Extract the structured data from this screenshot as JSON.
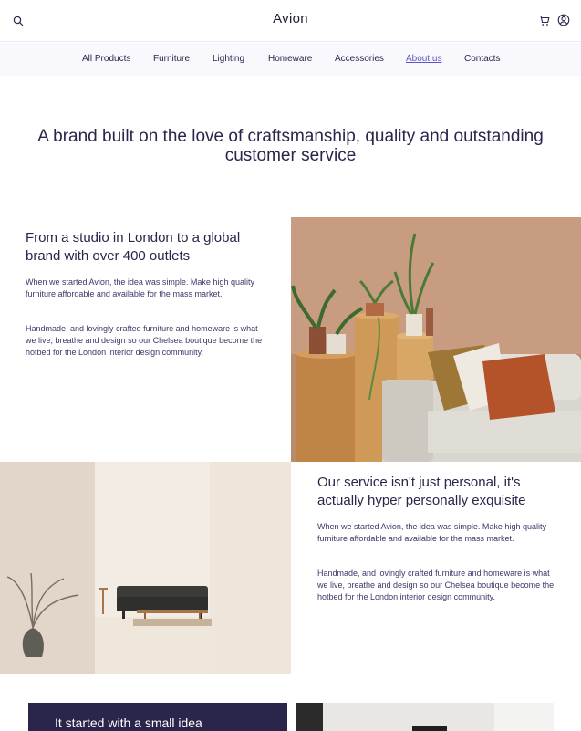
{
  "header": {
    "brand": "Avion",
    "icons": [
      "search-icon",
      "cart-icon",
      "user-icon"
    ]
  },
  "nav": {
    "items": [
      {
        "label": "All Products"
      },
      {
        "label": "Furniture"
      },
      {
        "label": "Lighting"
      },
      {
        "label": "Homeware"
      },
      {
        "label": "Accessories"
      },
      {
        "label": "About us",
        "active": true
      },
      {
        "label": "Contacts"
      }
    ]
  },
  "hero": {
    "title": "A brand built on the love of craftsmanship, quality and outstanding customer service"
  },
  "section1": {
    "heading": "From a studio in London to a global brand with over 400 outlets",
    "paragraph1": "When we started Avion, the idea was simple. Make high quality furniture affordable and available for the mass market.",
    "paragraph2": "Handmade, and lovingly crafted furniture and homeware is what we live, breathe and design so our Chelsea boutique become the hotbed for the London interior design community."
  },
  "section2": {
    "heading": "Our service isn't just personal, it's actually hyper personally exquisite",
    "paragraph1": "When we started Avion, the idea was simple. Make high quality furniture affordable and available for the mass market.",
    "paragraph2": "Handmade, and lovingly crafted furniture and homeware is what we live, breathe and design so our Chelsea boutique become the hotbed for the London interior design community."
  },
  "section3": {
    "heading": "It started with a small idea"
  },
  "colors": {
    "primary": "#2a254b",
    "nav_background": "#f9f9fd",
    "active_link": "#5b54cb"
  }
}
